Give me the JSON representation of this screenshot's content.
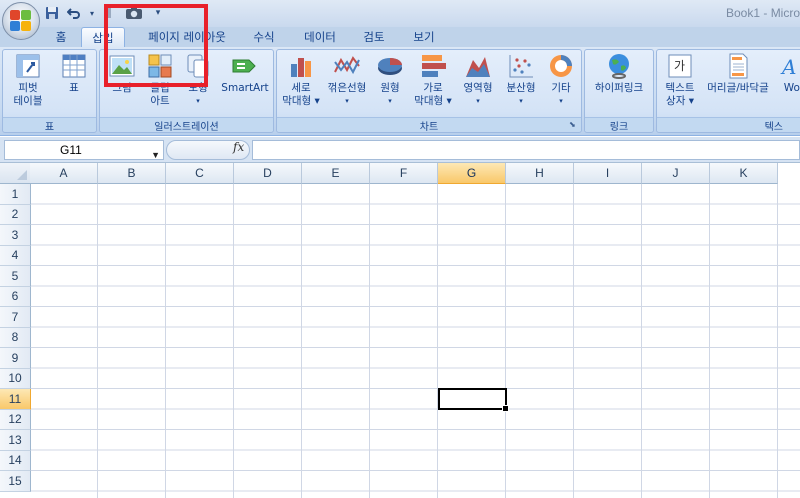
{
  "window": {
    "title": "Book1 - Micro"
  },
  "quick_access": {
    "items": [
      "save-icon",
      "undo-icon",
      "redo-icon",
      "camera-icon",
      "customize-icon"
    ]
  },
  "tabs": [
    {
      "label": "홈",
      "active": false
    },
    {
      "label": "삽입",
      "active": true
    },
    {
      "label": "페이지 레이아웃",
      "active": false
    },
    {
      "label": "수식",
      "active": false
    },
    {
      "label": "데이터",
      "active": false
    },
    {
      "label": "검토",
      "active": false
    },
    {
      "label": "보기",
      "active": false
    }
  ],
  "ribbon": {
    "groups": {
      "table": "표",
      "illustrations": "일러스트레이션",
      "charts": "차트",
      "links": "링크",
      "text": "텍스"
    },
    "buttons": {
      "pivot_line1": "피벗",
      "pivot_line2": "테이블",
      "table": "표",
      "picture": "그림",
      "clipart_line1": "클립",
      "clipart_line2": "아트",
      "shapes": "도형",
      "smartart": "SmartArt",
      "column_line1": "세로",
      "column_line2": "막대형",
      "line_chart": "꺾은선형",
      "pie_chart": "원형",
      "bar_line1": "가로",
      "bar_line2": "막대형",
      "area_chart": "영역형",
      "scatter_chart": "분산형",
      "other_chart": "기타",
      "hyperlink": "하이퍼링크",
      "textbox_line1": "텍스트",
      "textbox_line2": "상자",
      "header_footer": "머리글/바닥글",
      "wordart": "Wor"
    }
  },
  "formula_bar": {
    "name_box": "G11",
    "fx": "fx",
    "value": ""
  },
  "sheet": {
    "columns": [
      "A",
      "B",
      "C",
      "D",
      "E",
      "F",
      "G",
      "H",
      "I",
      "J",
      "K"
    ],
    "rows": [
      "1",
      "2",
      "3",
      "4",
      "5",
      "6",
      "7",
      "8",
      "9",
      "10",
      "11",
      "12",
      "13",
      "14",
      "15"
    ],
    "selected_column": "G",
    "selected_row": "11"
  },
  "colors": {
    "highlight": "#e8202a",
    "selected_header": "#f9c86a",
    "ribbon": "#c7daf1"
  }
}
